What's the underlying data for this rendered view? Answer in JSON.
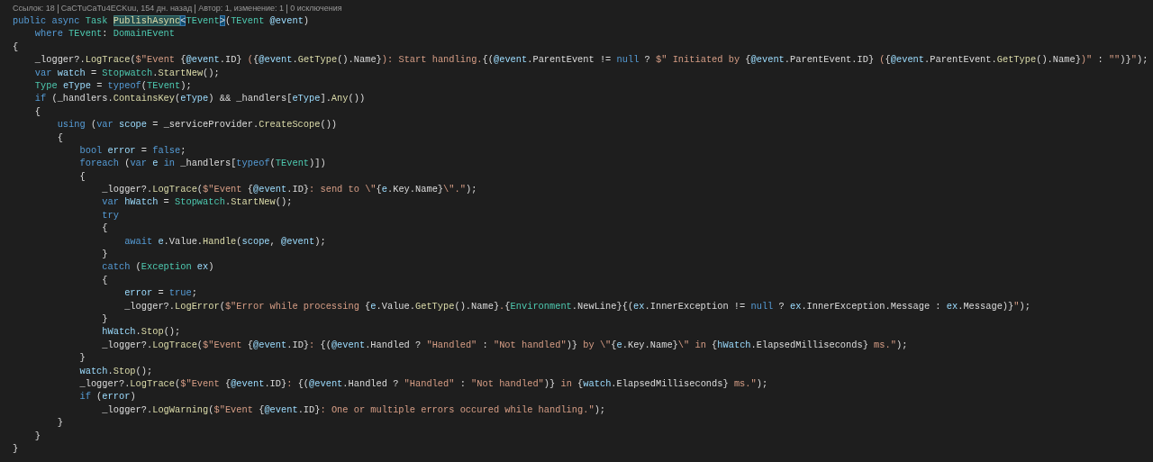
{
  "codelens": [
    {
      "text": "Ссылок: 18"
    },
    {
      "text": "CaCTuCaTu4ECKuu, 154 дн. назад"
    },
    {
      "text": "Автор: 1, изменение: 1"
    },
    {
      "text": "0 исключения"
    }
  ],
  "code_lines": [
    {
      "tokens": [
        {
          "kind": "keyword",
          "text": "public async "
        },
        {
          "kind": "type",
          "text": "Task "
        },
        {
          "kind": "highlight",
          "text": "PublishAsync"
        },
        {
          "kind": "bracket",
          "text": "<"
        },
        {
          "kind": "type",
          "text": "TEvent"
        },
        {
          "kind": "bracket",
          "text": ">"
        },
        {
          "kind": "plain",
          "text": "("
        },
        {
          "kind": "type",
          "text": "TEvent "
        },
        {
          "kind": "variable",
          "text": "@event"
        },
        {
          "kind": "plain",
          "text": ")"
        }
      ]
    },
    {
      "tokens": [
        {
          "kind": "keyword",
          "text": "    where "
        },
        {
          "kind": "type",
          "text": "TEvent"
        },
        {
          "kind": "plain",
          "text": ": "
        },
        {
          "kind": "type",
          "text": "DomainEvent"
        }
      ]
    },
    {
      "tokens": [
        {
          "kind": "plain",
          "text": "{"
        }
      ]
    },
    {
      "tokens": [
        {
          "kind": "plain",
          "text": "    _logger?."
        },
        {
          "kind": "method",
          "text": "LogTrace"
        },
        {
          "kind": "plain",
          "text": "("
        },
        {
          "kind": "string",
          "text": "$\"Event "
        },
        {
          "kind": "plain",
          "text": "{"
        },
        {
          "kind": "variable",
          "text": "@event"
        },
        {
          "kind": "plain",
          "text": ".ID}"
        },
        {
          "kind": "string",
          "text": " ("
        },
        {
          "kind": "plain",
          "text": "{"
        },
        {
          "kind": "variable",
          "text": "@event"
        },
        {
          "kind": "plain",
          "text": "."
        },
        {
          "kind": "method",
          "text": "GetType"
        },
        {
          "kind": "plain",
          "text": "().Name}"
        },
        {
          "kind": "string",
          "text": "): Start handling."
        },
        {
          "kind": "plain",
          "text": "{("
        },
        {
          "kind": "variable",
          "text": "@event"
        },
        {
          "kind": "plain",
          "text": ".ParentEvent != "
        },
        {
          "kind": "keyword",
          "text": "null"
        },
        {
          "kind": "plain",
          "text": " ? "
        },
        {
          "kind": "string",
          "text": "$\" Initiated by "
        },
        {
          "kind": "plain",
          "text": "{"
        },
        {
          "kind": "variable",
          "text": "@event"
        },
        {
          "kind": "plain",
          "text": ".ParentEvent.ID}"
        },
        {
          "kind": "string",
          "text": " ("
        },
        {
          "kind": "plain",
          "text": "{"
        },
        {
          "kind": "variable",
          "text": "@event"
        },
        {
          "kind": "plain",
          "text": ".ParentEvent."
        },
        {
          "kind": "method",
          "text": "GetType"
        },
        {
          "kind": "plain",
          "text": "().Name}"
        },
        {
          "kind": "string",
          "text": ")\""
        },
        {
          "kind": "plain",
          "text": " : "
        },
        {
          "kind": "string",
          "text": "\"\""
        },
        {
          "kind": "plain",
          "text": ")}"
        },
        {
          "kind": "string",
          "text": "\""
        },
        {
          "kind": "plain",
          "text": ");"
        }
      ]
    },
    {
      "tokens": [
        {
          "kind": "keyword",
          "text": "    var "
        },
        {
          "kind": "variable",
          "text": "watch"
        },
        {
          "kind": "plain",
          "text": " = "
        },
        {
          "kind": "type",
          "text": "Stopwatch"
        },
        {
          "kind": "plain",
          "text": "."
        },
        {
          "kind": "method",
          "text": "StartNew"
        },
        {
          "kind": "plain",
          "text": "();"
        }
      ]
    },
    {
      "tokens": [
        {
          "kind": "type",
          "text": "    Type "
        },
        {
          "kind": "variable",
          "text": "eType"
        },
        {
          "kind": "plain",
          "text": " = "
        },
        {
          "kind": "keyword",
          "text": "typeof"
        },
        {
          "kind": "plain",
          "text": "("
        },
        {
          "kind": "type",
          "text": "TEvent"
        },
        {
          "kind": "plain",
          "text": ");"
        }
      ]
    },
    {
      "tokens": [
        {
          "kind": "keyword",
          "text": "    if "
        },
        {
          "kind": "plain",
          "text": "(_handlers."
        },
        {
          "kind": "method",
          "text": "ContainsKey"
        },
        {
          "kind": "plain",
          "text": "("
        },
        {
          "kind": "variable",
          "text": "eType"
        },
        {
          "kind": "plain",
          "text": ") && _handlers["
        },
        {
          "kind": "variable",
          "text": "eType"
        },
        {
          "kind": "plain",
          "text": "]."
        },
        {
          "kind": "method",
          "text": "Any"
        },
        {
          "kind": "plain",
          "text": "())"
        }
      ]
    },
    {
      "tokens": [
        {
          "kind": "plain",
          "text": "    {"
        }
      ]
    },
    {
      "tokens": [
        {
          "kind": "keyword",
          "text": "        using "
        },
        {
          "kind": "plain",
          "text": "("
        },
        {
          "kind": "keyword",
          "text": "var "
        },
        {
          "kind": "variable",
          "text": "scope"
        },
        {
          "kind": "plain",
          "text": " = _serviceProvider."
        },
        {
          "kind": "method",
          "text": "CreateScope"
        },
        {
          "kind": "plain",
          "text": "())"
        }
      ]
    },
    {
      "tokens": [
        {
          "kind": "plain",
          "text": "        {"
        }
      ]
    },
    {
      "tokens": [
        {
          "kind": "keyword",
          "text": "            bool "
        },
        {
          "kind": "variable",
          "text": "error"
        },
        {
          "kind": "plain",
          "text": " = "
        },
        {
          "kind": "keyword",
          "text": "false"
        },
        {
          "kind": "plain",
          "text": ";"
        }
      ]
    },
    {
      "tokens": [
        {
          "kind": "keyword",
          "text": "            foreach "
        },
        {
          "kind": "plain",
          "text": "("
        },
        {
          "kind": "keyword",
          "text": "var "
        },
        {
          "kind": "variable",
          "text": "e "
        },
        {
          "kind": "keyword",
          "text": "in "
        },
        {
          "kind": "plain",
          "text": "_handlers["
        },
        {
          "kind": "keyword",
          "text": "typeof"
        },
        {
          "kind": "plain",
          "text": "("
        },
        {
          "kind": "type",
          "text": "TEvent"
        },
        {
          "kind": "plain",
          "text": ")])"
        }
      ]
    },
    {
      "tokens": [
        {
          "kind": "plain",
          "text": "            {"
        }
      ]
    },
    {
      "tokens": [
        {
          "kind": "plain",
          "text": "                _logger?."
        },
        {
          "kind": "method",
          "text": "LogTrace"
        },
        {
          "kind": "plain",
          "text": "("
        },
        {
          "kind": "string",
          "text": "$\"Event "
        },
        {
          "kind": "plain",
          "text": "{"
        },
        {
          "kind": "variable",
          "text": "@event"
        },
        {
          "kind": "plain",
          "text": ".ID}"
        },
        {
          "kind": "string",
          "text": ": send to \\\""
        },
        {
          "kind": "plain",
          "text": "{"
        },
        {
          "kind": "variable",
          "text": "e"
        },
        {
          "kind": "plain",
          "text": ".Key.Name}"
        },
        {
          "kind": "string",
          "text": "\\\".\""
        },
        {
          "kind": "plain",
          "text": ");"
        }
      ]
    },
    {
      "tokens": [
        {
          "kind": "keyword",
          "text": "                var "
        },
        {
          "kind": "variable",
          "text": "hWatch"
        },
        {
          "kind": "plain",
          "text": " = "
        },
        {
          "kind": "type",
          "text": "Stopwatch"
        },
        {
          "kind": "plain",
          "text": "."
        },
        {
          "kind": "method",
          "text": "StartNew"
        },
        {
          "kind": "plain",
          "text": "();"
        }
      ]
    },
    {
      "tokens": [
        {
          "kind": "keyword",
          "text": "                try"
        }
      ]
    },
    {
      "tokens": [
        {
          "kind": "plain",
          "text": "                {"
        }
      ]
    },
    {
      "tokens": [
        {
          "kind": "keyword",
          "text": "                    await "
        },
        {
          "kind": "variable",
          "text": "e"
        },
        {
          "kind": "plain",
          "text": ".Value."
        },
        {
          "kind": "method",
          "text": "Handle"
        },
        {
          "kind": "plain",
          "text": "("
        },
        {
          "kind": "variable",
          "text": "scope"
        },
        {
          "kind": "plain",
          "text": ", "
        },
        {
          "kind": "variable",
          "text": "@event"
        },
        {
          "kind": "plain",
          "text": ");"
        }
      ]
    },
    {
      "tokens": [
        {
          "kind": "plain",
          "text": "                }"
        }
      ]
    },
    {
      "tokens": [
        {
          "kind": "keyword",
          "text": "                catch "
        },
        {
          "kind": "plain",
          "text": "("
        },
        {
          "kind": "type",
          "text": "Exception "
        },
        {
          "kind": "variable",
          "text": "ex"
        },
        {
          "kind": "plain",
          "text": ")"
        }
      ]
    },
    {
      "tokens": [
        {
          "kind": "plain",
          "text": "                {"
        }
      ]
    },
    {
      "tokens": [
        {
          "kind": "variable",
          "text": "                    error"
        },
        {
          "kind": "plain",
          "text": " = "
        },
        {
          "kind": "keyword",
          "text": "true"
        },
        {
          "kind": "plain",
          "text": ";"
        }
      ]
    },
    {
      "tokens": [
        {
          "kind": "plain",
          "text": "                    _logger?."
        },
        {
          "kind": "method",
          "text": "LogError"
        },
        {
          "kind": "plain",
          "text": "("
        },
        {
          "kind": "string",
          "text": "$\"Error while processing "
        },
        {
          "kind": "plain",
          "text": "{"
        },
        {
          "kind": "variable",
          "text": "e"
        },
        {
          "kind": "plain",
          "text": ".Value."
        },
        {
          "kind": "method",
          "text": "GetType"
        },
        {
          "kind": "plain",
          "text": "().Name}"
        },
        {
          "kind": "string",
          "text": "."
        },
        {
          "kind": "plain",
          "text": "{"
        },
        {
          "kind": "type",
          "text": "Environment"
        },
        {
          "kind": "plain",
          "text": ".NewLine}{("
        },
        {
          "kind": "variable",
          "text": "ex"
        },
        {
          "kind": "plain",
          "text": ".InnerException != "
        },
        {
          "kind": "keyword",
          "text": "null"
        },
        {
          "kind": "plain",
          "text": " ? "
        },
        {
          "kind": "variable",
          "text": "ex"
        },
        {
          "kind": "plain",
          "text": ".InnerException.Message : "
        },
        {
          "kind": "variable",
          "text": "ex"
        },
        {
          "kind": "plain",
          "text": ".Message)}"
        },
        {
          "kind": "string",
          "text": "\""
        },
        {
          "kind": "plain",
          "text": ");"
        }
      ]
    },
    {
      "tokens": [
        {
          "kind": "plain",
          "text": "                }"
        }
      ]
    },
    {
      "tokens": [
        {
          "kind": "variable",
          "text": "                hWatch"
        },
        {
          "kind": "plain",
          "text": "."
        },
        {
          "kind": "method",
          "text": "Stop"
        },
        {
          "kind": "plain",
          "text": "();"
        }
      ]
    },
    {
      "tokens": [
        {
          "kind": "plain",
          "text": "                _logger?."
        },
        {
          "kind": "method",
          "text": "LogTrace"
        },
        {
          "kind": "plain",
          "text": "("
        },
        {
          "kind": "string",
          "text": "$\"Event "
        },
        {
          "kind": "plain",
          "text": "{"
        },
        {
          "kind": "variable",
          "text": "@event"
        },
        {
          "kind": "plain",
          "text": ".ID}"
        },
        {
          "kind": "string",
          "text": ": "
        },
        {
          "kind": "plain",
          "text": "{("
        },
        {
          "kind": "variable",
          "text": "@event"
        },
        {
          "kind": "plain",
          "text": ".Handled ? "
        },
        {
          "kind": "string",
          "text": "\"Handled\""
        },
        {
          "kind": "plain",
          "text": " : "
        },
        {
          "kind": "string",
          "text": "\"Not handled\""
        },
        {
          "kind": "plain",
          "text": ")}"
        },
        {
          "kind": "string",
          "text": " by \\\""
        },
        {
          "kind": "plain",
          "text": "{"
        },
        {
          "kind": "variable",
          "text": "e"
        },
        {
          "kind": "plain",
          "text": ".Key.Name}"
        },
        {
          "kind": "string",
          "text": "\\\" in "
        },
        {
          "kind": "plain",
          "text": "{"
        },
        {
          "kind": "variable",
          "text": "hWatch"
        },
        {
          "kind": "plain",
          "text": ".ElapsedMilliseconds}"
        },
        {
          "kind": "string",
          "text": " ms.\""
        },
        {
          "kind": "plain",
          "text": ");"
        }
      ]
    },
    {
      "tokens": [
        {
          "kind": "plain",
          "text": "            }"
        }
      ]
    },
    {
      "tokens": [
        {
          "kind": "variable",
          "text": "            watch"
        },
        {
          "kind": "plain",
          "text": "."
        },
        {
          "kind": "method",
          "text": "Stop"
        },
        {
          "kind": "plain",
          "text": "();"
        }
      ]
    },
    {
      "tokens": [
        {
          "kind": "plain",
          "text": "            _logger?."
        },
        {
          "kind": "method",
          "text": "LogTrace"
        },
        {
          "kind": "plain",
          "text": "("
        },
        {
          "kind": "string",
          "text": "$\"Event "
        },
        {
          "kind": "plain",
          "text": "{"
        },
        {
          "kind": "variable",
          "text": "@event"
        },
        {
          "kind": "plain",
          "text": ".ID}"
        },
        {
          "kind": "string",
          "text": ": "
        },
        {
          "kind": "plain",
          "text": "{("
        },
        {
          "kind": "variable",
          "text": "@event"
        },
        {
          "kind": "plain",
          "text": ".Handled ? "
        },
        {
          "kind": "string",
          "text": "\"Handled\""
        },
        {
          "kind": "plain",
          "text": " : "
        },
        {
          "kind": "string",
          "text": "\"Not handled\""
        },
        {
          "kind": "plain",
          "text": ")}"
        },
        {
          "kind": "string",
          "text": " in "
        },
        {
          "kind": "plain",
          "text": "{"
        },
        {
          "kind": "variable",
          "text": "watch"
        },
        {
          "kind": "plain",
          "text": ".ElapsedMilliseconds}"
        },
        {
          "kind": "string",
          "text": " ms.\""
        },
        {
          "kind": "plain",
          "text": ");"
        }
      ]
    },
    {
      "tokens": [
        {
          "kind": "keyword",
          "text": "            if "
        },
        {
          "kind": "plain",
          "text": "("
        },
        {
          "kind": "variable",
          "text": "error"
        },
        {
          "kind": "plain",
          "text": ")"
        }
      ]
    },
    {
      "tokens": [
        {
          "kind": "plain",
          "text": "                _logger?."
        },
        {
          "kind": "method",
          "text": "LogWarning"
        },
        {
          "kind": "plain",
          "text": "("
        },
        {
          "kind": "string",
          "text": "$\"Event "
        },
        {
          "kind": "plain",
          "text": "{"
        },
        {
          "kind": "variable",
          "text": "@event"
        },
        {
          "kind": "plain",
          "text": ".ID}"
        },
        {
          "kind": "string",
          "text": ": One or multiple errors occured while handling.\""
        },
        {
          "kind": "plain",
          "text": ");"
        }
      ]
    },
    {
      "tokens": [
        {
          "kind": "plain",
          "text": "        }"
        }
      ]
    },
    {
      "tokens": [
        {
          "kind": "plain",
          "text": "    }"
        }
      ]
    },
    {
      "tokens": [
        {
          "kind": "plain",
          "text": "}"
        }
      ]
    }
  ]
}
